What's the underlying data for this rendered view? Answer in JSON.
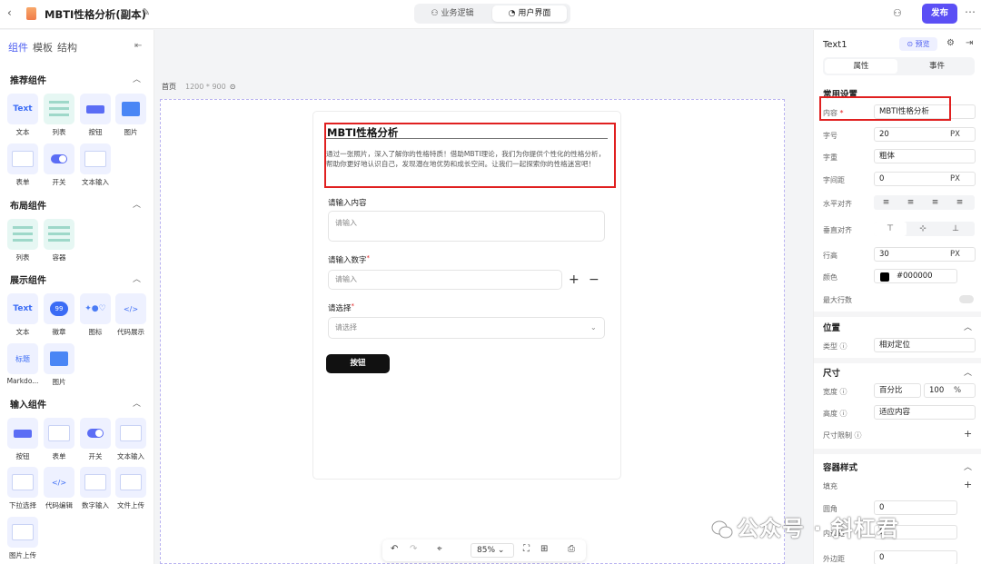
{
  "topbar": {
    "back": "‹",
    "title": "MBTI性格分析(副本)",
    "edit": "✎",
    "tab_logic": "业务逻辑",
    "tab_ui": "用户界面",
    "icon_logic": "⚇",
    "icon_ui": "◔",
    "user_icon": "⚇",
    "publish": "发布",
    "more": "⋯"
  },
  "left": {
    "tabs": [
      "组件",
      "模板",
      "结构"
    ],
    "collapse": "⇤",
    "sections": [
      {
        "title": "推荐组件",
        "items": [
          "文本",
          "列表",
          "按钮",
          "图片",
          "表单",
          "开关",
          "文本输入"
        ]
      },
      {
        "title": "布局组件",
        "items": [
          "列表",
          "容器"
        ]
      },
      {
        "title": "展示组件",
        "items": [
          "文本",
          "徽章",
          "图标",
          "代码展示",
          "Markdo...",
          "图片"
        ]
      },
      {
        "title": "输入组件",
        "items": [
          "按钮",
          "表单",
          "开关",
          "文本输入",
          "下拉选择",
          "代码编辑",
          "数字输入",
          "文件上传",
          "图片上传"
        ]
      }
    ],
    "tile_text": "Text",
    "tile_badge": "99",
    "tile_code": "</>",
    "tile_md": "标题"
  },
  "canvas": {
    "crumb": "首页",
    "size": "1200 * 900",
    "title": "MBTI性格分析",
    "desc": "通过一张照片，深入了解你的性格特质！借助MBTI理论，我们为你提供个性化的性格分析，帮助你更好地认识自己，发现潜在地优势和成长空间。让我们一起探索你的性格迷宫吧！",
    "field1_label": "请输入内容",
    "field1_ph": "请输入",
    "field2_label": "请输入数字",
    "field2_ph": "请输入",
    "plus": "+",
    "minus": "−",
    "field3_label": "请选择",
    "field3_ph": "请选择",
    "required": "*",
    "button": "按钮",
    "chev": "⌄"
  },
  "bottombar": {
    "undo": "↶",
    "redo": "↷",
    "mouse": "⌖",
    "zoom": "85%",
    "fit": "⛶",
    "grid": "⊞",
    "export": "⎙"
  },
  "right": {
    "name": "Text1",
    "preview": "⊙ 预览",
    "tab_props": "属性",
    "tab_events": "事件",
    "sec_common": "常用设置",
    "content_label": "内容",
    "content_value": "MBTI性格分析",
    "size_label": "字号",
    "size_value": "20",
    "px": "PX",
    "weight_label": "字重",
    "weight_value": "粗体",
    "spacing_label": "字间距",
    "spacing_value": "0",
    "halign_label": "水平对齐",
    "halign_icons": [
      "≡",
      "≡",
      "≡",
      "≡"
    ],
    "valign_label": "垂直对齐",
    "valign_icons": [
      "⊤",
      "⊹",
      "⊥"
    ],
    "lh_label": "行高",
    "lh_value": "30",
    "color_label": "颜色",
    "color_value": "#000000",
    "maxlines_label": "最大行数",
    "sec_pos": "位置",
    "type_label": "类型",
    "type_value": "相对定位",
    "sec_size": "尺寸",
    "width_label": "宽度",
    "width_unit": "百分比",
    "width_value": "100",
    "pct": "%",
    "height_label": "高度",
    "height_value": "适应内容",
    "limit_label": "尺寸限制",
    "sec_container": "容器样式",
    "fill_label": "填充",
    "radius_label": "圆角",
    "radius_value": "0",
    "border_label": "内边距",
    "border_value": "0",
    "margin_label": "外边距",
    "margin_value": "0",
    "add": "+"
  },
  "watermark": "公众号 · 斜杠君",
  "colors": {
    "accent": "#5b4ff5",
    "highlight": "#e02020"
  }
}
